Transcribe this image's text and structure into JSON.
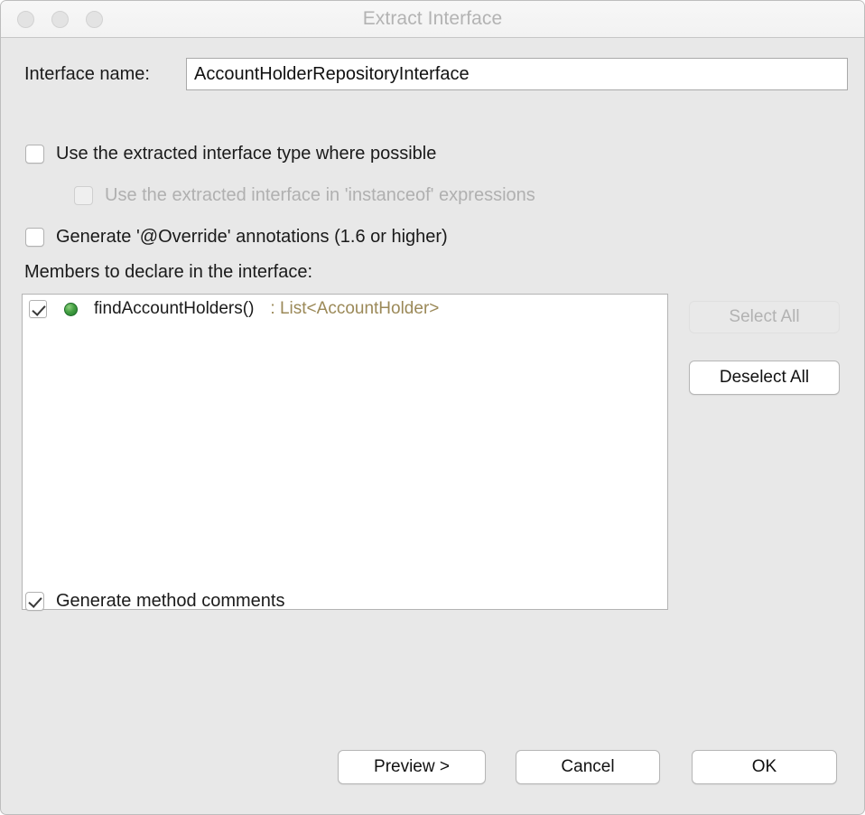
{
  "window": {
    "title": "Extract Interface",
    "traffic_lights": [
      "close",
      "minimize",
      "maximize"
    ],
    "title_color": "#b3b3b3",
    "background_color": "#e8e8e8"
  },
  "form": {
    "interface_name_label": "Interface name:",
    "interface_name_value": "AccountHolderRepositoryInterface",
    "interface_name_placeholder": "Interface name"
  },
  "options": [
    {
      "id": "use-type",
      "label": "Use the extracted interface type where possible",
      "checked": false,
      "enabled": true,
      "indented": false
    },
    {
      "id": "instanceof",
      "label": "Use the extracted interface in 'instanceof' expressions",
      "checked": false,
      "enabled": false,
      "indented": true
    },
    {
      "id": "override",
      "label": "Generate '@Override' annotations (1.6 or higher)",
      "checked": false,
      "enabled": true,
      "indented": false
    }
  ],
  "members": {
    "section_label": "Members to declare in the interface:",
    "rows": [
      {
        "checked": true,
        "icon": "public-method-icon",
        "name": "findAccountHolders()",
        "return_type": ": List<AccountHolder>",
        "return_type_color": "#9b8958"
      }
    ]
  },
  "side_buttons": [
    {
      "id": "select-all",
      "label": "Select All",
      "enabled": false
    },
    {
      "id": "deselect-all",
      "label": "Deselect All",
      "enabled": true
    }
  ],
  "generate_comments": {
    "label": "Generate method comments",
    "checked": true,
    "enabled": true
  },
  "footer_buttons": [
    {
      "id": "preview",
      "label": "Preview >",
      "enabled": true
    },
    {
      "id": "cancel",
      "label": "Cancel",
      "enabled": true
    },
    {
      "id": "ok",
      "label": "OK",
      "enabled": true
    }
  ]
}
